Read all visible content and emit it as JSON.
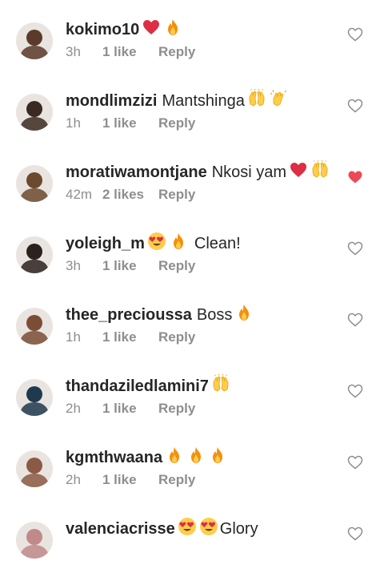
{
  "comments": [
    {
      "username": "kokimo10",
      "text": "",
      "emojis": [
        "red-heart",
        "fire"
      ],
      "time": "3h",
      "likes": "1 like",
      "reply": "Reply",
      "liked": false,
      "avatar_color": "#5a3a2a"
    },
    {
      "username": "mondlimzizi",
      "text": "Mantshinga",
      "emojis": [
        "raising-hands",
        "clapping-hands"
      ],
      "time": "1h",
      "likes": "1 like",
      "reply": "Reply",
      "liked": false,
      "avatar_color": "#3b2a22"
    },
    {
      "username": "moratiwamontjane",
      "text": "Nkosi yam",
      "emojis": [
        "red-heart",
        "raising-hands"
      ],
      "time": "42m",
      "likes": "2 likes",
      "reply": "Reply",
      "liked": true,
      "avatar_color": "#6b4a2e"
    },
    {
      "username": "yoleigh_m",
      "text": "Clean!",
      "emojis": [
        "heart-eyes",
        "fire"
      ],
      "time": "3h",
      "likes": "1 like",
      "reply": "Reply",
      "liked": false,
      "avatar_color": "#2b211d"
    },
    {
      "username": "thee_precioussa",
      "text": "Boss",
      "emojis": [
        "fire"
      ],
      "time": "1h",
      "likes": "1 like",
      "reply": "Reply",
      "liked": false,
      "avatar_color": "#7a4e36"
    },
    {
      "username": "thandaziledlamini7",
      "text": "",
      "emojis": [
        "raising-hands"
      ],
      "time": "2h",
      "likes": "1 like",
      "reply": "Reply",
      "liked": false,
      "avatar_color": "#1f3a4f"
    },
    {
      "username": "kgmthwaana",
      "text": "",
      "emojis": [
        "fire",
        "fire",
        "fire"
      ],
      "time": "2h",
      "likes": "1 like",
      "reply": "Reply",
      "liked": false,
      "avatar_color": "#8a5a44"
    },
    {
      "username": "valenciacrisse",
      "text": "Glory",
      "emojis": [
        "heart-eyes",
        "heart-eyes"
      ],
      "time": "",
      "likes": "",
      "reply": "",
      "liked": false,
      "avatar_color": "#c08a8a"
    }
  ],
  "colors": {
    "liked_heart": "#ed4956",
    "muted": "#8e8e8e",
    "text": "#262626"
  }
}
